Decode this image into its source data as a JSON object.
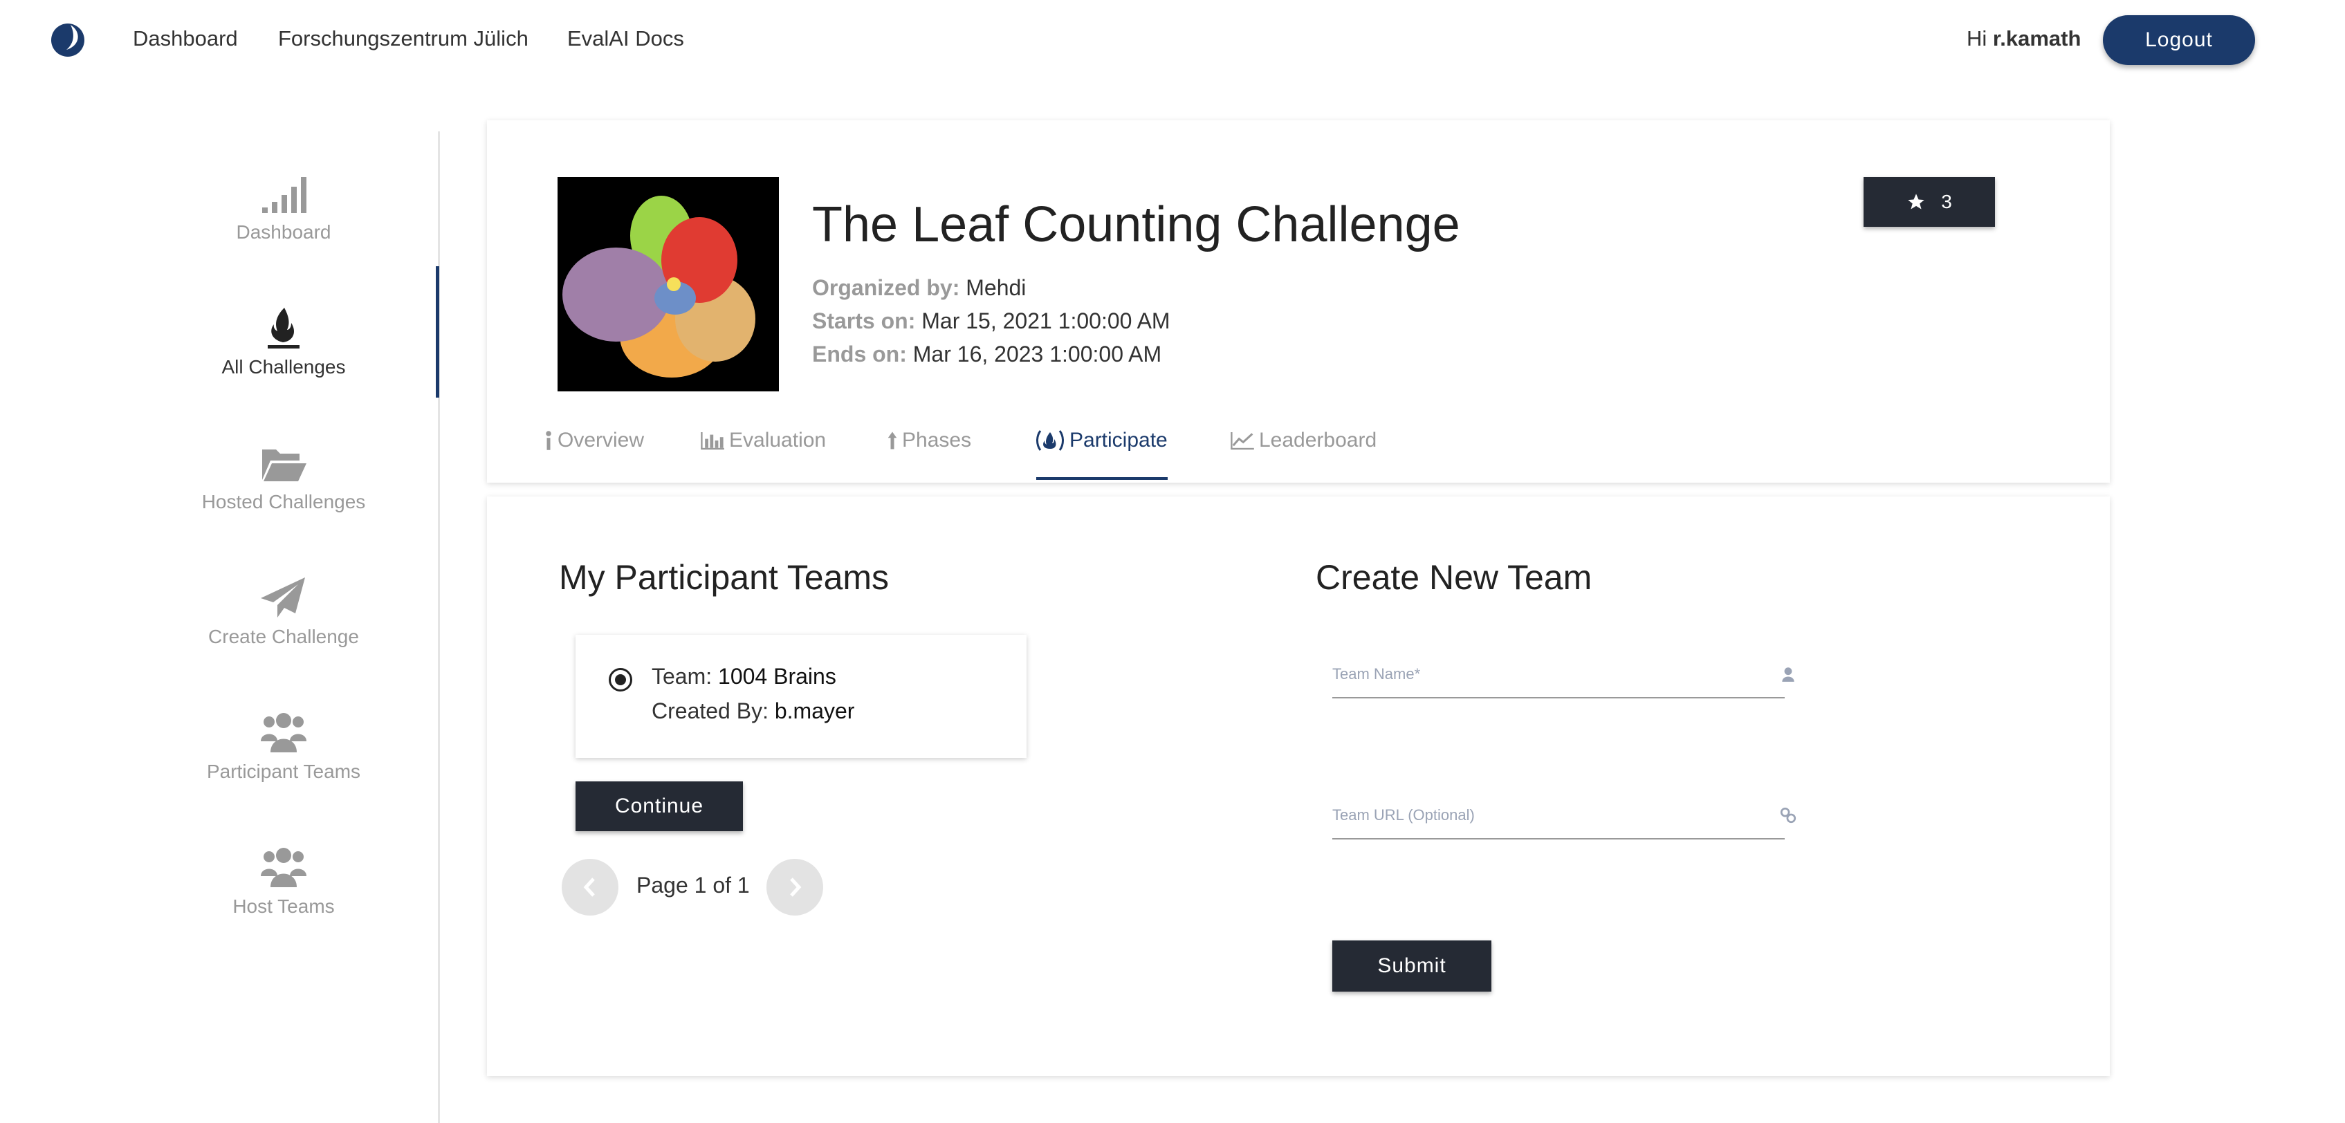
{
  "nav": {
    "links": [
      "Dashboard",
      "Forschungszentrum Jülich",
      "EvalAI Docs"
    ],
    "greeting_prefix": "Hi ",
    "username": "r.kamath",
    "logout_label": "Logout"
  },
  "sidebar": {
    "items": [
      {
        "label": "Dashboard",
        "icon": "bar-signal-icon"
      },
      {
        "label": "All Challenges",
        "icon": "flame-icon",
        "active": true
      },
      {
        "label": "Hosted Challenges",
        "icon": "folder-open-icon"
      },
      {
        "label": "Create Challenge",
        "icon": "paper-plane-icon"
      },
      {
        "label": "Participant Teams",
        "icon": "users-icon"
      },
      {
        "label": "Host Teams",
        "icon": "users-icon"
      }
    ]
  },
  "challenge": {
    "title": "The Leaf Counting Challenge",
    "organized_label": "Organized by:",
    "organizer": "Mehdi",
    "starts_label": "Starts on:",
    "starts": "Mar 15, 2021 1:00:00 AM",
    "ends_label": "Ends on:",
    "ends": "Mar 16, 2023 1:00:00 AM",
    "stars": "3"
  },
  "tabs": [
    {
      "label": "Overview",
      "icon": "info-icon"
    },
    {
      "label": "Evaluation",
      "icon": "bar-chart-icon"
    },
    {
      "label": "Phases",
      "icon": "arrow-up-icon"
    },
    {
      "label": "Participate",
      "icon": "fire-icon",
      "active": true
    },
    {
      "label": "Leaderboard",
      "icon": "line-chart-icon"
    }
  ],
  "participant": {
    "title": "My Participant Teams",
    "team_label": "Team: ",
    "team_name": "1004 Brains",
    "created_label": "Created By: ",
    "created_by": "b.mayer",
    "continue_label": "Continue",
    "page_text": "Page 1 of 1"
  },
  "create": {
    "title": "Create New Team",
    "name_placeholder": "Team Name*",
    "url_placeholder": "Team URL (Optional)",
    "submit_label": "Submit"
  },
  "colors": {
    "accent": "#1b3a6b",
    "dark_button": "#252a34"
  }
}
